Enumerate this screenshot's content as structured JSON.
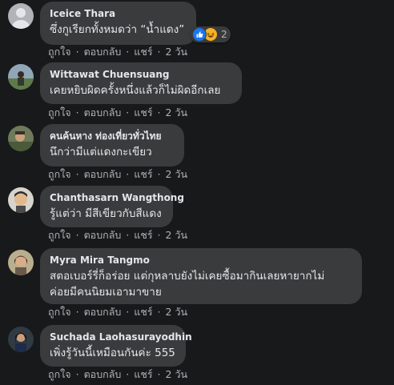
{
  "comments": [
    {
      "name": "Iceice Thara",
      "text": "ซึ่งกูเรียกทั้งหมดว่า “น้ำแดง”",
      "reaction_count": "2",
      "actions": {
        "like": "ถูกใจ",
        "reply": "ตอบกลับ",
        "share": "แชร์",
        "time": "2 วัน"
      }
    },
    {
      "name": "Wittawat Chuensuang",
      "text": "เคยหยิบผิดครั้งหนึ่งแล้วก็ไม่ผิดอีกเลย",
      "actions": {
        "like": "ถูกใจ",
        "reply": "ตอบกลับ",
        "share": "แชร์",
        "time": "2 วัน"
      }
    },
    {
      "name": "คนค้นหาง ท่องเที่ยวทั่วไทย",
      "text": "นึกว่ามีแต่แดงกะเขียว",
      "actions": {
        "like": "ถูกใจ",
        "reply": "ตอบกลับ",
        "share": "แชร์",
        "time": "2 วัน"
      }
    },
    {
      "name": "Chanthasarn Wangthong",
      "text": "รู้แต่ว่า มีสีเขียวกับสีแดง",
      "actions": {
        "like": "ถูกใจ",
        "reply": "ตอบกลับ",
        "share": "แชร์",
        "time": "2 วัน"
      }
    },
    {
      "name": "Myra Mira Tangmo",
      "text_line1": "สตอเบอร์รี่ก็อร่อย แต่กุหลาบยังไม่เคยซื้อมากินเลยหายากไม่",
      "text_line2": "ค่อยมีคนนิยมเอามาขาย",
      "actions": {
        "like": "ถูกใจ",
        "reply": "ตอบกลับ",
        "share": "แชร์",
        "time": "2 วัน"
      }
    },
    {
      "name": "Suchada Laohasurayodhin",
      "text": "เพิ่งรู้วันนี้เหมือนกันค่ะ 555",
      "actions": {
        "like": "ถูกใจ",
        "reply": "ตอบกลับ",
        "share": "แชร์",
        "time": "2 วัน"
      }
    }
  ],
  "colors": {
    "background": "#18191a",
    "bubble": "#3a3b3c",
    "text": "#e4e6eb",
    "secondary_text": "#b0b3b8",
    "like_blue": "#1877f2",
    "haha_yellow": "#f7b125"
  },
  "icons": {
    "like_reaction": "thumbs-up-icon",
    "haha_reaction": "laughing-face-icon"
  }
}
